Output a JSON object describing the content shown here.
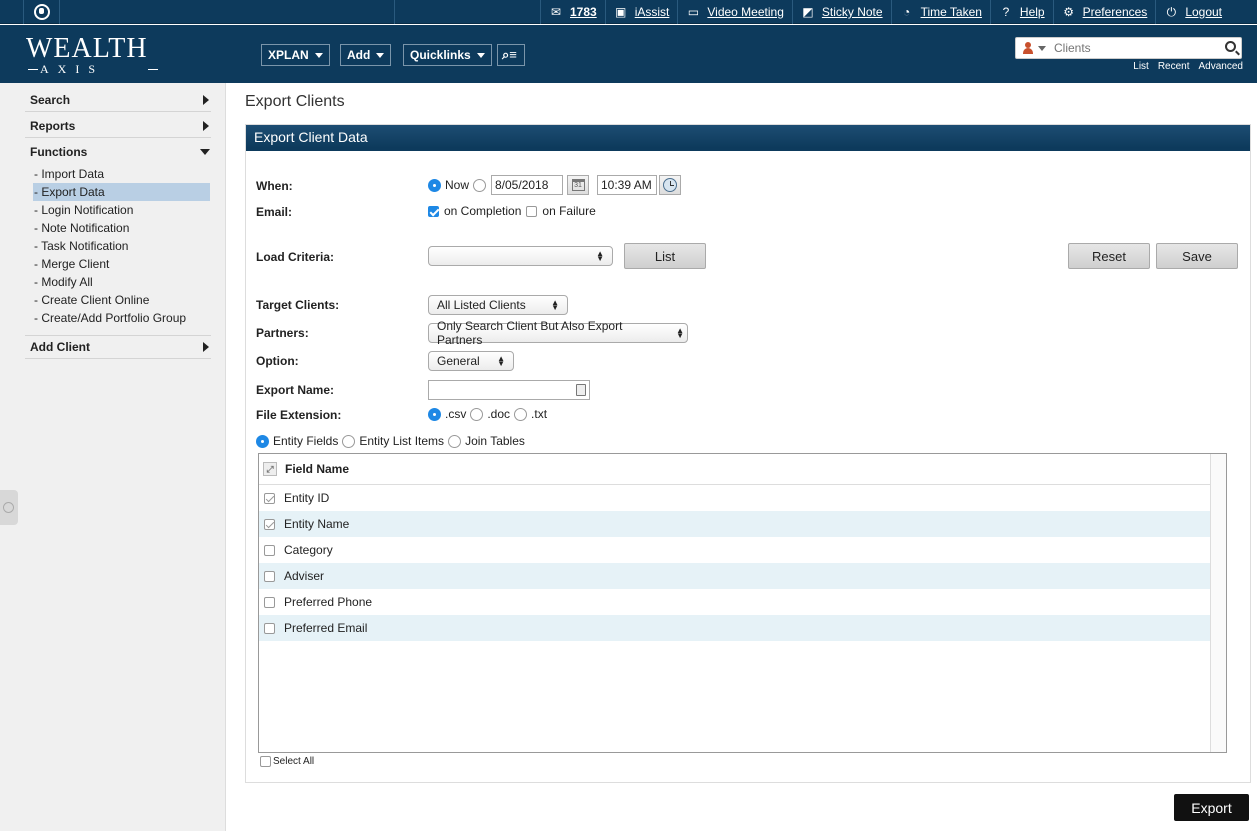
{
  "topbar": {
    "mail_count": "1783",
    "iassist": "iAssist",
    "video_meeting": "Video Meeting",
    "sticky_note": "Sticky Note",
    "time_taken": "Time Taken",
    "help": "Help",
    "preferences": "Preferences",
    "logout": "Logout"
  },
  "logo": {
    "line1": "WEALTH",
    "line2": "AXIS"
  },
  "nav": {
    "xplan": "XPLAN",
    "add": "Add",
    "quicklinks": "Quicklinks"
  },
  "search": {
    "placeholder": "Clients",
    "links": [
      "List",
      "Recent",
      "Advanced"
    ]
  },
  "sidebar": {
    "search": "Search",
    "reports": "Reports",
    "functions": "Functions",
    "items": [
      "- Import Data",
      "- Export Data",
      "- Login Notification",
      "- Note Notification",
      "- Task Notification",
      "- Merge Client",
      "- Modify All",
      "- Create Client Online",
      "- Create/Add Portfolio Group"
    ],
    "add_client": "Add Client"
  },
  "page": {
    "title": "Export Clients",
    "panel_title": "Export Client Data"
  },
  "form": {
    "when_label": "When:",
    "now": "Now",
    "date": "8/05/2018",
    "time": "10:39 AM",
    "email_label": "Email:",
    "on_completion": "on Completion",
    "on_failure": "on Failure",
    "load_criteria_label": "Load Criteria:",
    "load_criteria_value": "",
    "list_btn": "List",
    "reset_btn": "Reset",
    "save_btn": "Save",
    "target_clients_label": "Target Clients:",
    "target_clients_value": "All Listed Clients",
    "partners_label": "Partners:",
    "partners_value": "Only Search Client But Also Export Partners",
    "option_label": "Option:",
    "option_value": "General",
    "export_name_label": "Export Name:",
    "export_name_value": "",
    "file_extension_label": "File Extension:",
    "ext_csv": ".csv",
    "ext_doc": ".doc",
    "ext_txt": ".txt",
    "tab_entity_fields": "Entity Fields",
    "tab_entity_list_items": "Entity List Items",
    "tab_join_tables": "Join Tables"
  },
  "grid": {
    "header": "Field Name",
    "rows": [
      "Entity ID",
      "Entity Name",
      "Category",
      "Adviser",
      "Preferred Phone",
      "Preferred Email"
    ],
    "select_all": "Select All"
  },
  "export_btn": "Export"
}
